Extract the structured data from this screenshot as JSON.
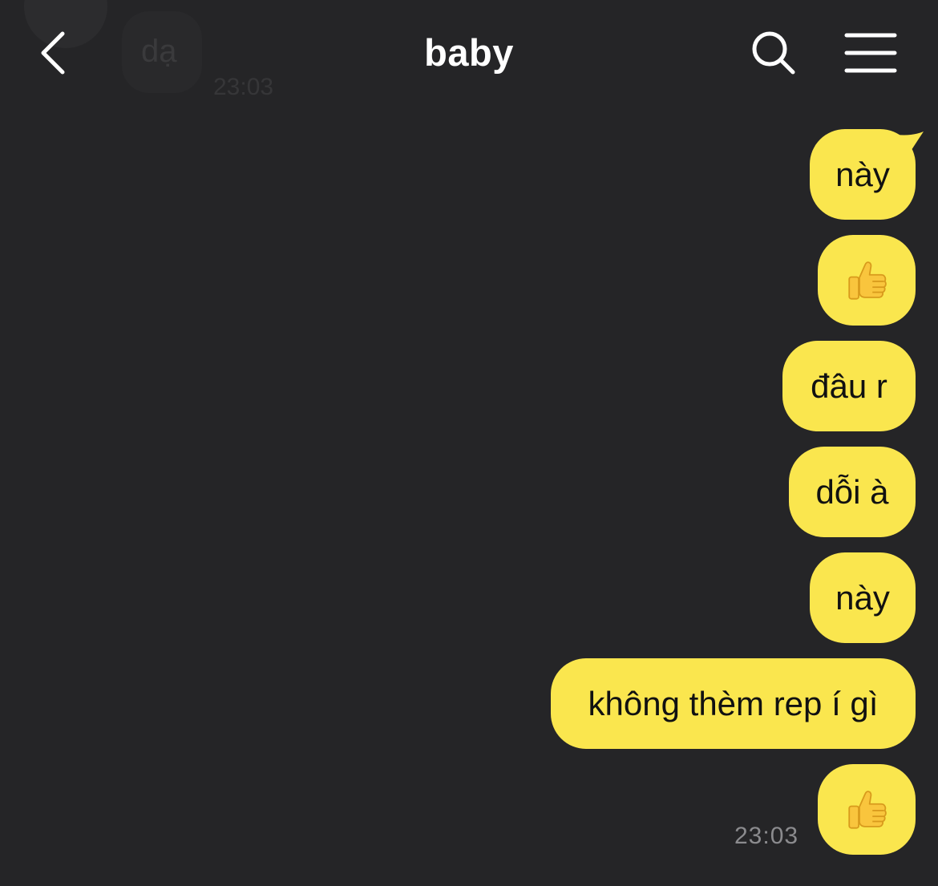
{
  "header": {
    "title": "baby",
    "back_icon": "chevron-left-icon",
    "search_icon": "search-icon",
    "menu_icon": "hamburger-menu-icon"
  },
  "previous_message": {
    "text": "dạ",
    "time": "23:03"
  },
  "messages": [
    {
      "text": "này"
    },
    {
      "emoji": "thumbs-up-icon"
    },
    {
      "text": "đâu r"
    },
    {
      "text": "dỗi à"
    },
    {
      "text": "này"
    },
    {
      "text": "không thèm rep í gì"
    },
    {
      "emoji": "thumbs-up-icon"
    }
  ],
  "last_message_time": "23:03",
  "colors": {
    "background": "#252527",
    "bubble": "#fae64e",
    "text": "#111111",
    "timestamp": "#8b8b8e"
  }
}
